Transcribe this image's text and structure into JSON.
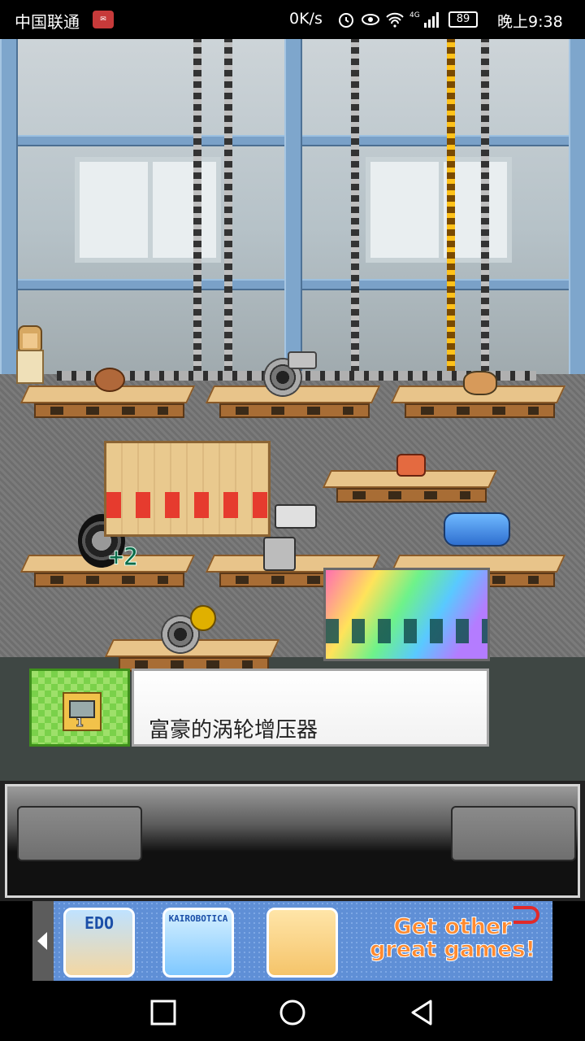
{
  "status_bar": {
    "carrier": "中国联通",
    "speed": "0K/s",
    "network": "4G",
    "battery": "89",
    "time": "晚上9:38"
  },
  "scene": {
    "bonus_label": "+2",
    "items": [
      "turbo-charger",
      "spray-gun",
      "nitro-tank",
      "tire",
      "meat",
      "rock"
    ]
  },
  "notification": {
    "item_name": "富豪的涡轮增压器",
    "level": "1"
  },
  "ad": {
    "games": [
      "EDO",
      "KAIROBOTICA",
      ""
    ],
    "cta": "Get other great games!"
  },
  "nav_bar": {
    "icons": [
      "recent-apps-icon",
      "home-icon",
      "back-icon"
    ]
  }
}
